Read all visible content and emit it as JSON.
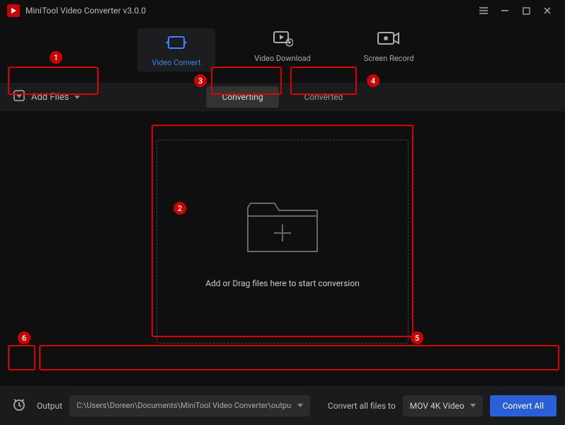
{
  "titlebar": {
    "title": "MiniTool Video Converter v3.0.0"
  },
  "topTabs": {
    "convert": "Video Convert",
    "download": "Video Download",
    "record": "Screen Record"
  },
  "toolbar": {
    "addFiles": "Add Files"
  },
  "centerTabs": {
    "converting": "Converting",
    "converted": "Converted"
  },
  "dropzone": {
    "label": "Add or Drag files here to start conversion"
  },
  "bottom": {
    "outputLabel": "Output",
    "outputPath": "C:\\Users\\Doreen\\Documents\\MiniTool Video Converter\\outpu",
    "convertTo": "Convert all files to",
    "format": "MOV 4K Video",
    "convertAll": "Convert All"
  },
  "annotations": {
    "1": "1",
    "2": "2",
    "3": "3",
    "4": "4",
    "5": "5",
    "6": "6"
  },
  "colors": {
    "accent": "#3b82f6",
    "primary": "#2b5fd9",
    "callout": "#c00"
  }
}
